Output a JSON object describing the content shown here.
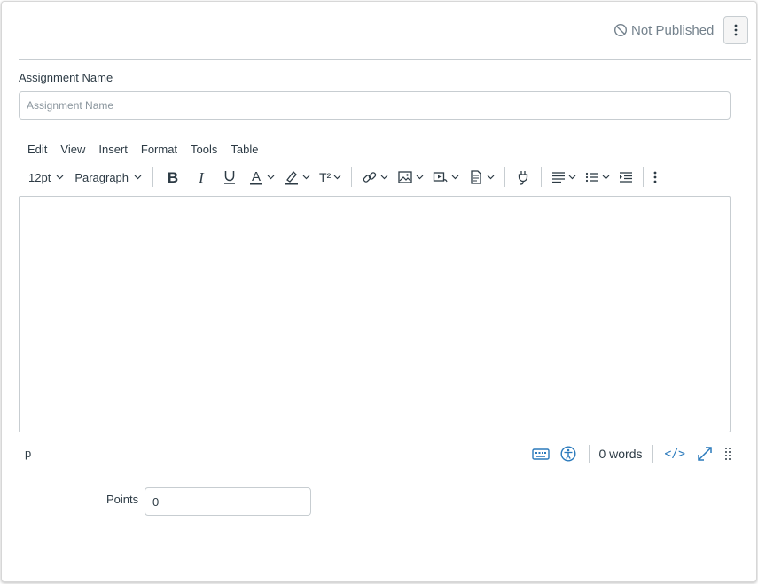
{
  "header": {
    "publish_status": "Not Published",
    "options_icon": "kebab-vertical-icon"
  },
  "assignment_name": {
    "label": "Assignment Name",
    "placeholder": "Assignment Name",
    "value": ""
  },
  "editor": {
    "menus": [
      "Edit",
      "View",
      "Insert",
      "Format",
      "Tools",
      "Table"
    ],
    "toolbar": {
      "font_size": "12pt",
      "block_format": "Paragraph",
      "superscript_label": "T²"
    },
    "status": {
      "path": "p",
      "word_count": "0 words",
      "html_toggle": "</>"
    }
  },
  "points": {
    "label": "Points",
    "value": "0"
  },
  "colors": {
    "accent": "#2b7abc",
    "text": "#2d3b45",
    "muted": "#73818c",
    "border": "#c7cdd1"
  }
}
